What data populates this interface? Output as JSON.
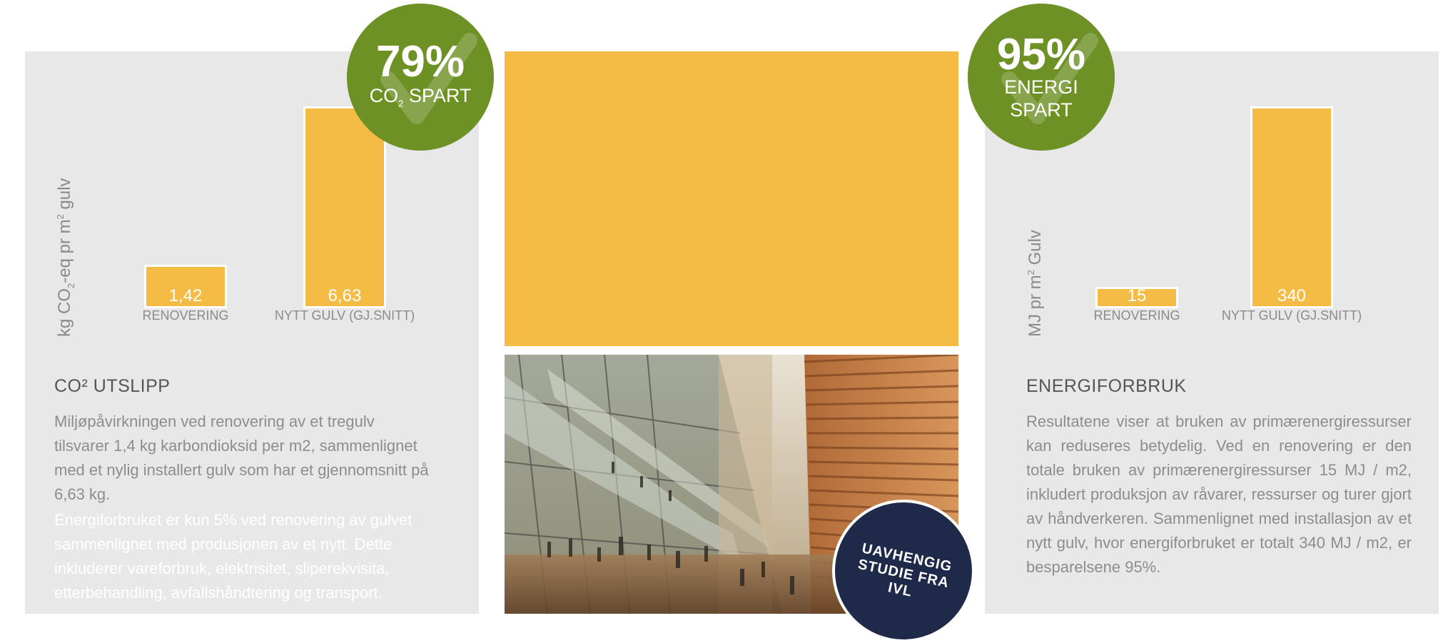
{
  "co2": {
    "badge_percent": "79%",
    "badge_label": "CO₂ SPART",
    "y_axis_label": "kg CO₂-eq pr m² gulv",
    "heading": "CO² UTSLIPP",
    "paragraph_1": "Miljøpåvirkningen ved renovering av et tregulv tilsvarer 1,4 kg karbondioksid per m2, sammenlignet med et nylig installert gulv som har et gjennomsnitt på 6,63 kg.",
    "paragraph_2": "Energiforbruket er kun 5% ved renovering av gulvet sammenlignet med produsjonen av et nytt. Dette inkluderer vareforbruk, elektrisitet, sliperekvisita, etterbehandling, avfallshåndtering og transport."
  },
  "energy": {
    "badge_percent": "95%",
    "badge_label_line1": "ENERGI",
    "badge_label_line2": "SPART",
    "y_axis_label": "MJ pr m² Gulv",
    "heading": "ENERGIFORBRUK",
    "paragraph": "Resultatene viser at bruken av primærenergiressurser kan reduseres betydelig. Ved en renovering er den totale bruken av primærenergiressurser 15 MJ / m2, inkludert produksjon av råvarer, ressurser og turer gjort av håndverkeren. Sammenlignet med installasjon av et nytt gulv, hvor energiforbruket er totalt 340 MJ / m2, er besparelsene 95%."
  },
  "ivl_badge": {
    "line1": "UAVHENGIG",
    "line2": "STUDIE FRA",
    "line3": "IVL"
  },
  "colors": {
    "bar": "#f4bc45",
    "badge_green": "#6e9126",
    "badge_navy": "#1f2a4b",
    "panel": "#e8e8e8"
  },
  "chart_data": [
    {
      "type": "bar",
      "categories": [
        "RENOVERING",
        "NYTT GULV (GJ.SNITT)"
      ],
      "values": [
        1.42,
        6.63
      ],
      "value_labels": [
        "1,42",
        "6,63"
      ],
      "ylabel": "kg CO₂-eq pr m² gulv",
      "ylim": [
        0,
        6.63
      ]
    },
    {
      "type": "bar",
      "categories": [
        "RENOVERING",
        "NYTT GULV (GJ.SNITT)"
      ],
      "values": [
        15,
        340
      ],
      "value_labels": [
        "15",
        "340"
      ],
      "ylabel": "MJ pr m² Gulv",
      "ylim": [
        0,
        340
      ]
    }
  ]
}
